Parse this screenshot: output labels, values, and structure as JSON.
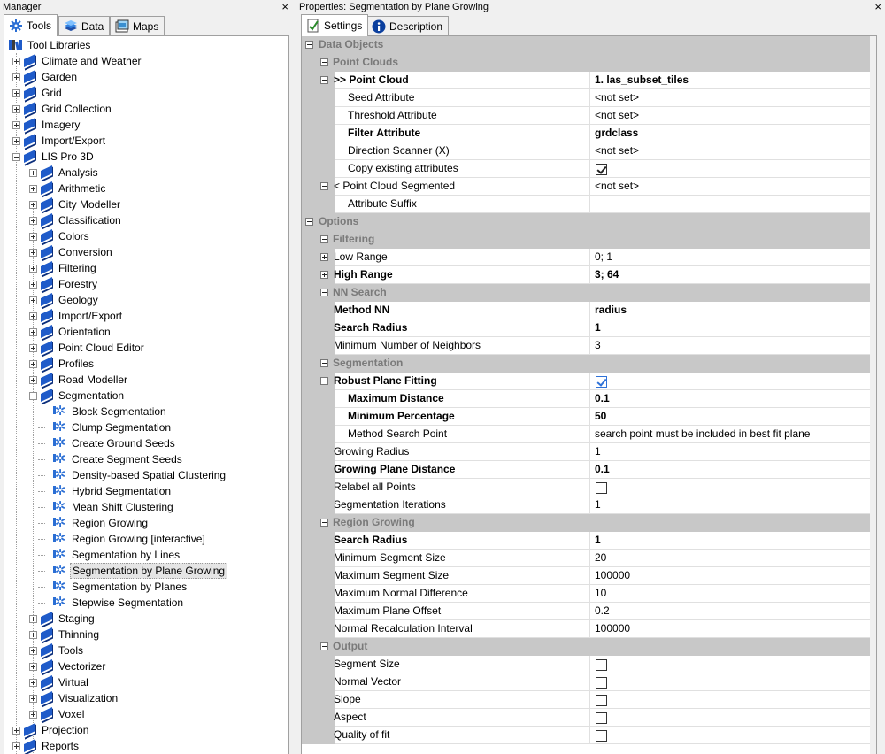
{
  "manager": {
    "title": "Manager",
    "close_icon": "×",
    "tabs": [
      {
        "label": "Tools",
        "icon": "tools-icon"
      },
      {
        "label": "Data",
        "icon": "data-icon"
      },
      {
        "label": "Maps",
        "icon": "maps-icon"
      }
    ],
    "tree": {
      "root": "Tool Libraries",
      "items": [
        {
          "label": "Climate and Weather",
          "level": 1,
          "expanded": false
        },
        {
          "label": "Garden",
          "level": 1,
          "expanded": false
        },
        {
          "label": "Grid",
          "level": 1,
          "expanded": false
        },
        {
          "label": "Grid Collection",
          "level": 1,
          "expanded": false
        },
        {
          "label": "Imagery",
          "level": 1,
          "expanded": false
        },
        {
          "label": "Import/Export",
          "level": 1,
          "expanded": false
        },
        {
          "label": "LIS Pro 3D",
          "level": 1,
          "expanded": true
        },
        {
          "label": "Analysis",
          "level": 2,
          "expanded": false
        },
        {
          "label": "Arithmetic",
          "level": 2,
          "expanded": false
        },
        {
          "label": "City Modeller",
          "level": 2,
          "expanded": false
        },
        {
          "label": "Classification",
          "level": 2,
          "expanded": false
        },
        {
          "label": "Colors",
          "level": 2,
          "expanded": false
        },
        {
          "label": "Conversion",
          "level": 2,
          "expanded": false
        },
        {
          "label": "Filtering",
          "level": 2,
          "expanded": false
        },
        {
          "label": "Forestry",
          "level": 2,
          "expanded": false
        },
        {
          "label": "Geology",
          "level": 2,
          "expanded": false
        },
        {
          "label": "Import/Export",
          "level": 2,
          "expanded": false
        },
        {
          "label": "Orientation",
          "level": 2,
          "expanded": false
        },
        {
          "label": "Point Cloud Editor",
          "level": 2,
          "expanded": false
        },
        {
          "label": "Profiles",
          "level": 2,
          "expanded": false
        },
        {
          "label": "Road Modeller",
          "level": 2,
          "expanded": false
        },
        {
          "label": "Segmentation",
          "level": 2,
          "expanded": true
        },
        {
          "label": "Block Segmentation",
          "level": 3,
          "tool": true
        },
        {
          "label": "Clump Segmentation",
          "level": 3,
          "tool": true
        },
        {
          "label": "Create Ground Seeds",
          "level": 3,
          "tool": true
        },
        {
          "label": "Create Segment Seeds",
          "level": 3,
          "tool": true
        },
        {
          "label": "Density-based Spatial Clustering",
          "level": 3,
          "tool": true
        },
        {
          "label": "Hybrid Segmentation",
          "level": 3,
          "tool": true
        },
        {
          "label": "Mean Shift Clustering",
          "level": 3,
          "tool": true
        },
        {
          "label": "Region Growing",
          "level": 3,
          "tool": true
        },
        {
          "label": "Region Growing [interactive]",
          "level": 3,
          "tool": true
        },
        {
          "label": "Segmentation by Lines",
          "level": 3,
          "tool": true
        },
        {
          "label": "Segmentation by Plane Growing",
          "level": 3,
          "tool": true,
          "selected": true
        },
        {
          "label": "Segmentation by Planes",
          "level": 3,
          "tool": true
        },
        {
          "label": "Stepwise Segmentation",
          "level": 3,
          "tool": true
        },
        {
          "label": "Staging",
          "level": 2,
          "expanded": false
        },
        {
          "label": "Thinning",
          "level": 2,
          "expanded": false
        },
        {
          "label": "Tools",
          "level": 2,
          "expanded": false
        },
        {
          "label": "Vectorizer",
          "level": 2,
          "expanded": false
        },
        {
          "label": "Virtual",
          "level": 2,
          "expanded": false
        },
        {
          "label": "Visualization",
          "level": 2,
          "expanded": false
        },
        {
          "label": "Voxel",
          "level": 2,
          "expanded": false
        },
        {
          "label": "Projection",
          "level": 1,
          "expanded": false
        },
        {
          "label": "Reports",
          "level": 1,
          "expanded": false
        }
      ]
    }
  },
  "properties": {
    "title": "Properties: Segmentation by Plane Growing",
    "close_icon": "×",
    "tabs": [
      {
        "label": "Settings",
        "icon": "settings-icon"
      },
      {
        "label": "Description",
        "icon": "info-icon"
      }
    ],
    "rows": [
      {
        "type": "cat",
        "level": 0,
        "label": "Data Objects"
      },
      {
        "type": "cat",
        "level": 1,
        "label": "Point Clouds"
      },
      {
        "type": "prop",
        "indent": 1,
        "exp": "minus",
        "label": ">> Point Cloud",
        "value": "1. las_subset_tiles",
        "bold": true
      },
      {
        "type": "prop",
        "indent": 2,
        "label": "Seed Attribute",
        "value": "<not set>"
      },
      {
        "type": "prop",
        "indent": 2,
        "label": "Threshold Attribute",
        "value": "<not set>"
      },
      {
        "type": "prop",
        "indent": 2,
        "label": "Filter Attribute",
        "value": "grdclass",
        "bold": true
      },
      {
        "type": "prop",
        "indent": 2,
        "label": "Direction Scanner (X)",
        "value": "<not set>"
      },
      {
        "type": "prop",
        "indent": 2,
        "label": "Copy existing attributes",
        "check": true,
        "checked": true
      },
      {
        "type": "prop",
        "indent": 1,
        "exp": "minus",
        "label": "< Point Cloud Segmented",
        "value": "<not set>"
      },
      {
        "type": "prop",
        "indent": 2,
        "label": "Attribute Suffix",
        "value": ""
      },
      {
        "type": "cat",
        "level": 0,
        "label": "Options"
      },
      {
        "type": "cat",
        "level": 1,
        "label": "Filtering"
      },
      {
        "type": "prop",
        "indent": 1,
        "exp": "plus",
        "label": "Low Range",
        "value": "0; 1"
      },
      {
        "type": "prop",
        "indent": 1,
        "exp": "plus",
        "label": "High Range",
        "value": "3; 64",
        "bold": true
      },
      {
        "type": "cat",
        "level": 1,
        "label": "NN Search"
      },
      {
        "type": "prop",
        "indent": 1,
        "label": "Method NN",
        "value": "radius",
        "bold": true
      },
      {
        "type": "prop",
        "indent": 1,
        "label": "Search Radius",
        "value": "1",
        "bold": true
      },
      {
        "type": "prop",
        "indent": 1,
        "label": "Minimum Number of Neighbors",
        "value": "3"
      },
      {
        "type": "cat",
        "level": 1,
        "label": "Segmentation"
      },
      {
        "type": "prop",
        "indent": 1,
        "exp": "minus",
        "label": "Robust Plane Fitting",
        "check": true,
        "checked": true,
        "blue": true,
        "bold": true
      },
      {
        "type": "prop",
        "indent": 2,
        "label": "Maximum Distance",
        "value": "0.1",
        "bold": true
      },
      {
        "type": "prop",
        "indent": 2,
        "label": "Minimum Percentage",
        "value": "50",
        "bold": true
      },
      {
        "type": "prop",
        "indent": 2,
        "label": "Method Search Point",
        "value": "search point must be included in best fit plane"
      },
      {
        "type": "prop",
        "indent": 1,
        "label": "Growing Radius",
        "value": "1"
      },
      {
        "type": "prop",
        "indent": 1,
        "label": "Growing Plane Distance",
        "value": "0.1",
        "bold": true
      },
      {
        "type": "prop",
        "indent": 1,
        "label": "Relabel all Points",
        "check": true,
        "checked": false
      },
      {
        "type": "prop",
        "indent": 1,
        "label": "Segmentation Iterations",
        "value": "1"
      },
      {
        "type": "cat",
        "level": 1,
        "label": "Region Growing"
      },
      {
        "type": "prop",
        "indent": 1,
        "label": "Search Radius",
        "value": "1",
        "bold": true
      },
      {
        "type": "prop",
        "indent": 1,
        "label": "Minimum Segment Size",
        "value": "20"
      },
      {
        "type": "prop",
        "indent": 1,
        "label": "Maximum Segment Size",
        "value": "100000"
      },
      {
        "type": "prop",
        "indent": 1,
        "label": "Maximum Normal Difference",
        "value": "10"
      },
      {
        "type": "prop",
        "indent": 1,
        "label": "Maximum Plane Offset",
        "value": "0.2"
      },
      {
        "type": "prop",
        "indent": 1,
        "label": "Normal Recalculation Interval",
        "value": "100000"
      },
      {
        "type": "cat",
        "level": 1,
        "label": "Output"
      },
      {
        "type": "prop",
        "indent": 1,
        "label": "Segment Size",
        "check": true,
        "checked": false
      },
      {
        "type": "prop",
        "indent": 1,
        "label": "Normal Vector",
        "check": true,
        "checked": false
      },
      {
        "type": "prop",
        "indent": 1,
        "label": "Slope",
        "check": true,
        "checked": false
      },
      {
        "type": "prop",
        "indent": 1,
        "label": "Aspect",
        "check": true,
        "checked": false
      },
      {
        "type": "prop",
        "indent": 1,
        "label": "Quality of fit",
        "check": true,
        "checked": false
      }
    ]
  }
}
